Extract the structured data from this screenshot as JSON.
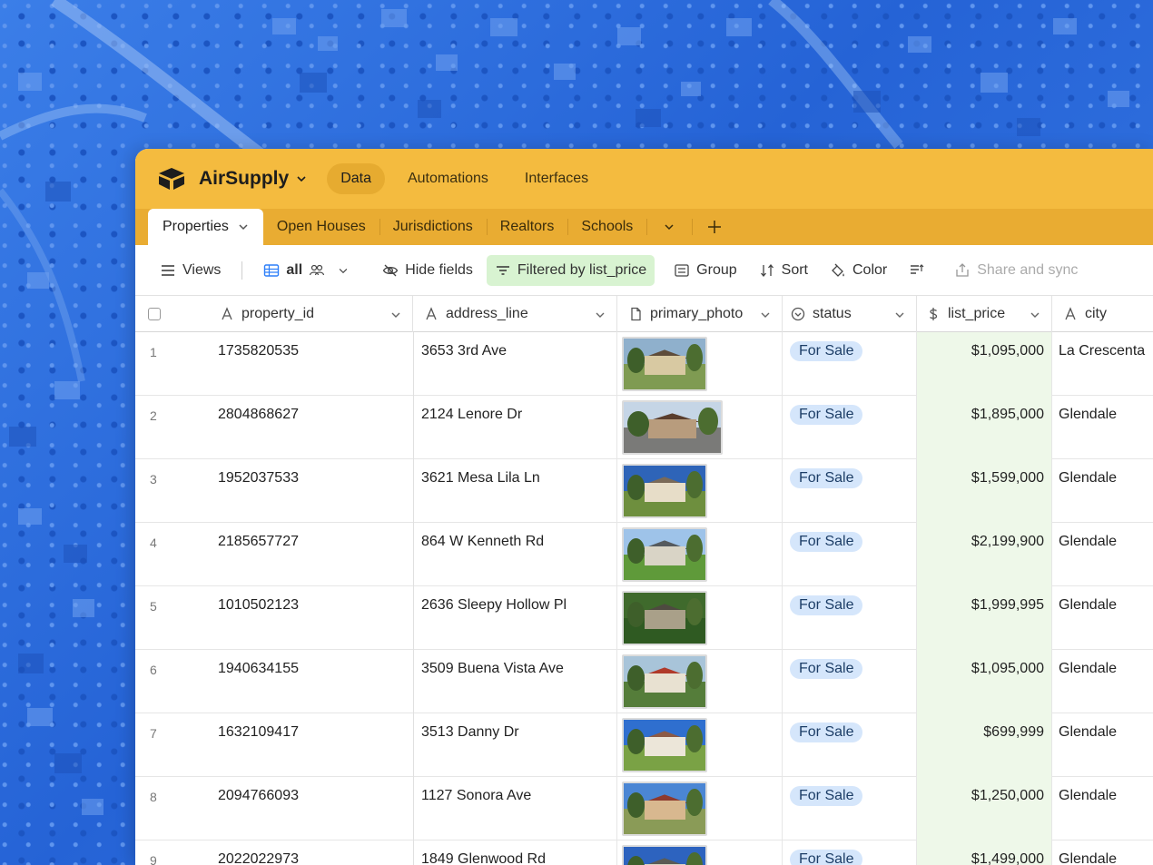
{
  "app": {
    "name": "AirSupply",
    "nav": [
      {
        "label": "Data",
        "active": true
      },
      {
        "label": "Automations",
        "active": false
      },
      {
        "label": "Interfaces",
        "active": false
      }
    ],
    "brand_color": "#f4bb3f"
  },
  "tabs": {
    "active": "Properties",
    "items": [
      "Open Houses",
      "Jurisdictions",
      "Realtors",
      "Schools"
    ]
  },
  "toolbar": {
    "views": "Views",
    "view_name": "all",
    "hide_fields": "Hide fields",
    "filter": "Filtered by list_price",
    "group": "Group",
    "sort": "Sort",
    "color": "Color",
    "share": "Share and sync"
  },
  "columns": {
    "property_id": "property_id",
    "address_line": "address_line",
    "primary_photo": "primary_photo",
    "status": "status",
    "list_price": "list_price",
    "city": "city"
  },
  "rows": [
    {
      "num": "1",
      "property_id": "1735820535",
      "address": "3653 3rd Ave",
      "status": "For Sale",
      "price": "$1,095,000",
      "city": "La Crescenta",
      "photo": {
        "sky": "#8fb0cc",
        "ground": "#7f9b52",
        "house": "#d8c9a2",
        "roof": "#5e4c3a",
        "w": 94
      }
    },
    {
      "num": "2",
      "property_id": "2804868627",
      "address": "2124 Lenore Dr",
      "status": "For Sale",
      "price": "$1,895,000",
      "city": "Glendale",
      "photo": {
        "sky": "#c5d5e6",
        "ground": "#7a7a78",
        "house": "#b89c7d",
        "roof": "#5a3e2e",
        "w": 111
      }
    },
    {
      "num": "3",
      "property_id": "1952037533",
      "address": "3621 Mesa Lila Ln",
      "status": "For Sale",
      "price": "$1,599,000",
      "city": "Glendale",
      "photo": {
        "sky": "#2e64b8",
        "ground": "#6e8f3e",
        "house": "#e7ddc8",
        "roof": "#7a6a58",
        "w": 94
      }
    },
    {
      "num": "4",
      "property_id": "2185657727",
      "address": "864 W Kenneth Rd",
      "status": "For Sale",
      "price": "$2,199,900",
      "city": "Glendale",
      "photo": {
        "sky": "#9ec3e9",
        "ground": "#5f9a3a",
        "house": "#d9d4c6",
        "roof": "#555a5e",
        "w": 94
      }
    },
    {
      "num": "5",
      "property_id": "1010502123",
      "address": "2636 Sleepy Hollow Pl",
      "status": "For Sale",
      "price": "$1,999,995",
      "city": "Glendale",
      "photo": {
        "sky": "#3f6a2c",
        "ground": "#2f5a22",
        "house": "#a9a089",
        "roof": "#4e4a40",
        "w": 94
      }
    },
    {
      "num": "6",
      "property_id": "1940634155",
      "address": "3509 Buena Vista Ave",
      "status": "For Sale",
      "price": "$1,095,000",
      "city": "Glendale",
      "photo": {
        "sky": "#a8c4d9",
        "ground": "#557d3a",
        "house": "#e8e1d1",
        "roof": "#b03a2a",
        "w": 94
      }
    },
    {
      "num": "7",
      "property_id": "1632109417",
      "address": "3513 Danny Dr",
      "status": "For Sale",
      "price": "$699,999",
      "city": "Glendale",
      "photo": {
        "sky": "#2f6fcf",
        "ground": "#7aa245",
        "house": "#ece6d9",
        "roof": "#8c5a45",
        "w": 94
      }
    },
    {
      "num": "8",
      "property_id": "2094766093",
      "address": "1127 Sonora Ave",
      "status": "For Sale",
      "price": "$1,250,000",
      "city": "Glendale",
      "photo": {
        "sky": "#4b86d4",
        "ground": "#8a9b57",
        "house": "#d8b88f",
        "roof": "#8e3a2e",
        "w": 94
      }
    },
    {
      "num": "9",
      "property_id": "2022022973",
      "address": "1849 Glenwood Rd",
      "status": "For Sale",
      "price": "$1,499,000",
      "city": "Glendale",
      "photo": {
        "sky": "#2d63bf",
        "ground": "#567b37",
        "house": "#d9d3c2",
        "roof": "#5b5b55",
        "w": 94
      }
    }
  ]
}
